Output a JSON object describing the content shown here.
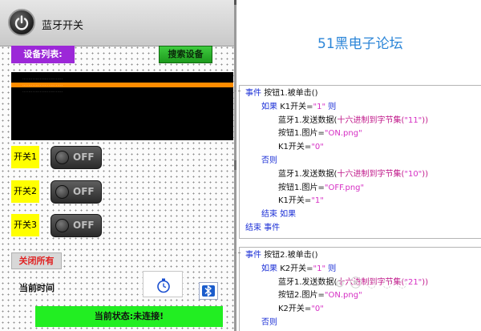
{
  "app": {
    "title": "蓝牙开关"
  },
  "device_panel": {
    "label": "设备列表:",
    "search_button": "搜索设备",
    "devices": [
      "............................",
      "............................",
      "............................"
    ]
  },
  "switches": [
    {
      "label": "开关1",
      "state": "OFF"
    },
    {
      "label": "开关2",
      "state": "OFF"
    },
    {
      "label": "开关3",
      "state": "OFF"
    }
  ],
  "close_all_button": "关闭所有",
  "current_time_label": "当前时间",
  "status": "当前状态:未连接!",
  "watermark": "51黑电子论坛",
  "icons": {
    "power": "power-icon",
    "timer": "stopwatch-icon",
    "bluetooth": "bluetooth-icon"
  },
  "code_blocks": [
    {
      "lines": [
        {
          "parts": [
            {
              "t": "事件 ",
              "c": "kw"
            },
            {
              "t": "按钮1.被单击()",
              "c": "txt"
            }
          ]
        },
        {
          "parts": [
            {
              "t": "如果 ",
              "c": "kw"
            },
            {
              "t": "K1开关=",
              "c": "txt"
            },
            {
              "t": "\"1\"",
              "c": "str"
            },
            {
              "t": " 则",
              "c": "kw"
            }
          ]
        },
        {
          "parts": [
            {
              "t": "蓝牙1.发送数据(",
              "c": "txt"
            },
            {
              "t": "十六进制到字节集(",
              "c": "fn"
            },
            {
              "t": "\"11\"",
              "c": "str"
            },
            {
              "t": "))",
              "c": "fn"
            }
          ]
        },
        {
          "parts": [
            {
              "t": "按钮1.图片=",
              "c": "txt"
            },
            {
              "t": "\"ON.png\"",
              "c": "str"
            }
          ]
        },
        {
          "parts": [
            {
              "t": "K1开关=",
              "c": "txt"
            },
            {
              "t": "\"0\"",
              "c": "str"
            }
          ]
        },
        {
          "parts": [
            {
              "t": "否则",
              "c": "kw"
            }
          ]
        },
        {
          "parts": [
            {
              "t": "蓝牙1.发送数据(",
              "c": "txt"
            },
            {
              "t": "十六进制到字节集(",
              "c": "fn"
            },
            {
              "t": "\"10\"",
              "c": "str"
            },
            {
              "t": "))",
              "c": "fn"
            }
          ]
        },
        {
          "parts": [
            {
              "t": "按钮1.图片=",
              "c": "txt"
            },
            {
              "t": "\"OFF.png\"",
              "c": "str"
            }
          ]
        },
        {
          "parts": [
            {
              "t": "K1开关=",
              "c": "txt"
            },
            {
              "t": "\"1\"",
              "c": "str"
            }
          ]
        },
        {
          "parts": [
            {
              "t": "结束 如果",
              "c": "kw"
            }
          ]
        },
        {
          "parts": [
            {
              "t": "结束 事件",
              "c": "kw"
            }
          ]
        }
      ]
    },
    {
      "lines": [
        {
          "parts": [
            {
              "t": "事件 ",
              "c": "kw"
            },
            {
              "t": "按钮2.被单击()",
              "c": "txt"
            }
          ]
        },
        {
          "parts": [
            {
              "t": "如果 ",
              "c": "kw"
            },
            {
              "t": "K2开关=",
              "c": "txt"
            },
            {
              "t": "\"1\"",
              "c": "str"
            },
            {
              "t": " 则",
              "c": "kw"
            }
          ]
        },
        {
          "parts": [
            {
              "t": "蓝牙1.发送数据(",
              "c": "txt"
            },
            {
              "t": "十六进制到字节集(",
              "c": "fn"
            },
            {
              "t": "\"21\"",
              "c": "str"
            },
            {
              "t": "))",
              "c": "fn"
            }
          ]
        },
        {
          "parts": [
            {
              "t": "按钮2.图片=",
              "c": "txt"
            },
            {
              "t": "\"ON.png\"",
              "c": "str"
            }
          ]
        },
        {
          "parts": [
            {
              "t": "K2开关=",
              "c": "txt"
            },
            {
              "t": "\"0\"",
              "c": "str"
            }
          ]
        },
        {
          "parts": [
            {
              "t": "否则",
              "c": "kw"
            }
          ]
        }
      ]
    }
  ]
}
